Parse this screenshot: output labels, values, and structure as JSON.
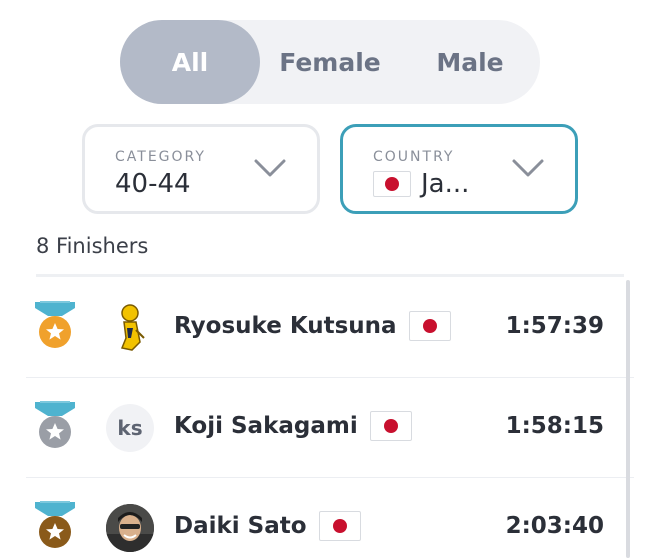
{
  "gender_filter": {
    "options": [
      "All",
      "Female",
      "Male"
    ],
    "selected": "All"
  },
  "category": {
    "label": "CATEGORY",
    "value": "40-44"
  },
  "country": {
    "label": "COUNTRY",
    "value": "Ja...",
    "flag_icon": "japan-flag-icon"
  },
  "finishers_text": "8 Finishers",
  "colors": {
    "accent": "#3c9fb8",
    "ribbon": "#4fb3cf",
    "gold": "#f0a12c",
    "silver": "#9a9ea6",
    "bronze": "#8a5a1a",
    "segment_active": "#b3bac8",
    "flag_red": "#c8102e"
  },
  "results": [
    {
      "name": "Ryosuke Kutsuna",
      "time": "1:57:39",
      "medal": "gold",
      "avatar_type": "image",
      "avatar_icon": "runner-figure-icon",
      "flag_icon": "japan-flag-icon"
    },
    {
      "name": "Koji Sakagami",
      "time": "1:58:15",
      "medal": "silver",
      "avatar_type": "initials",
      "initials": "ks",
      "flag_icon": "japan-flag-icon"
    },
    {
      "name": "Daiki Sato",
      "time": "2:03:40",
      "medal": "bronze",
      "avatar_type": "photo",
      "avatar_icon": "profile-photo-icon",
      "flag_icon": "japan-flag-icon"
    }
  ]
}
